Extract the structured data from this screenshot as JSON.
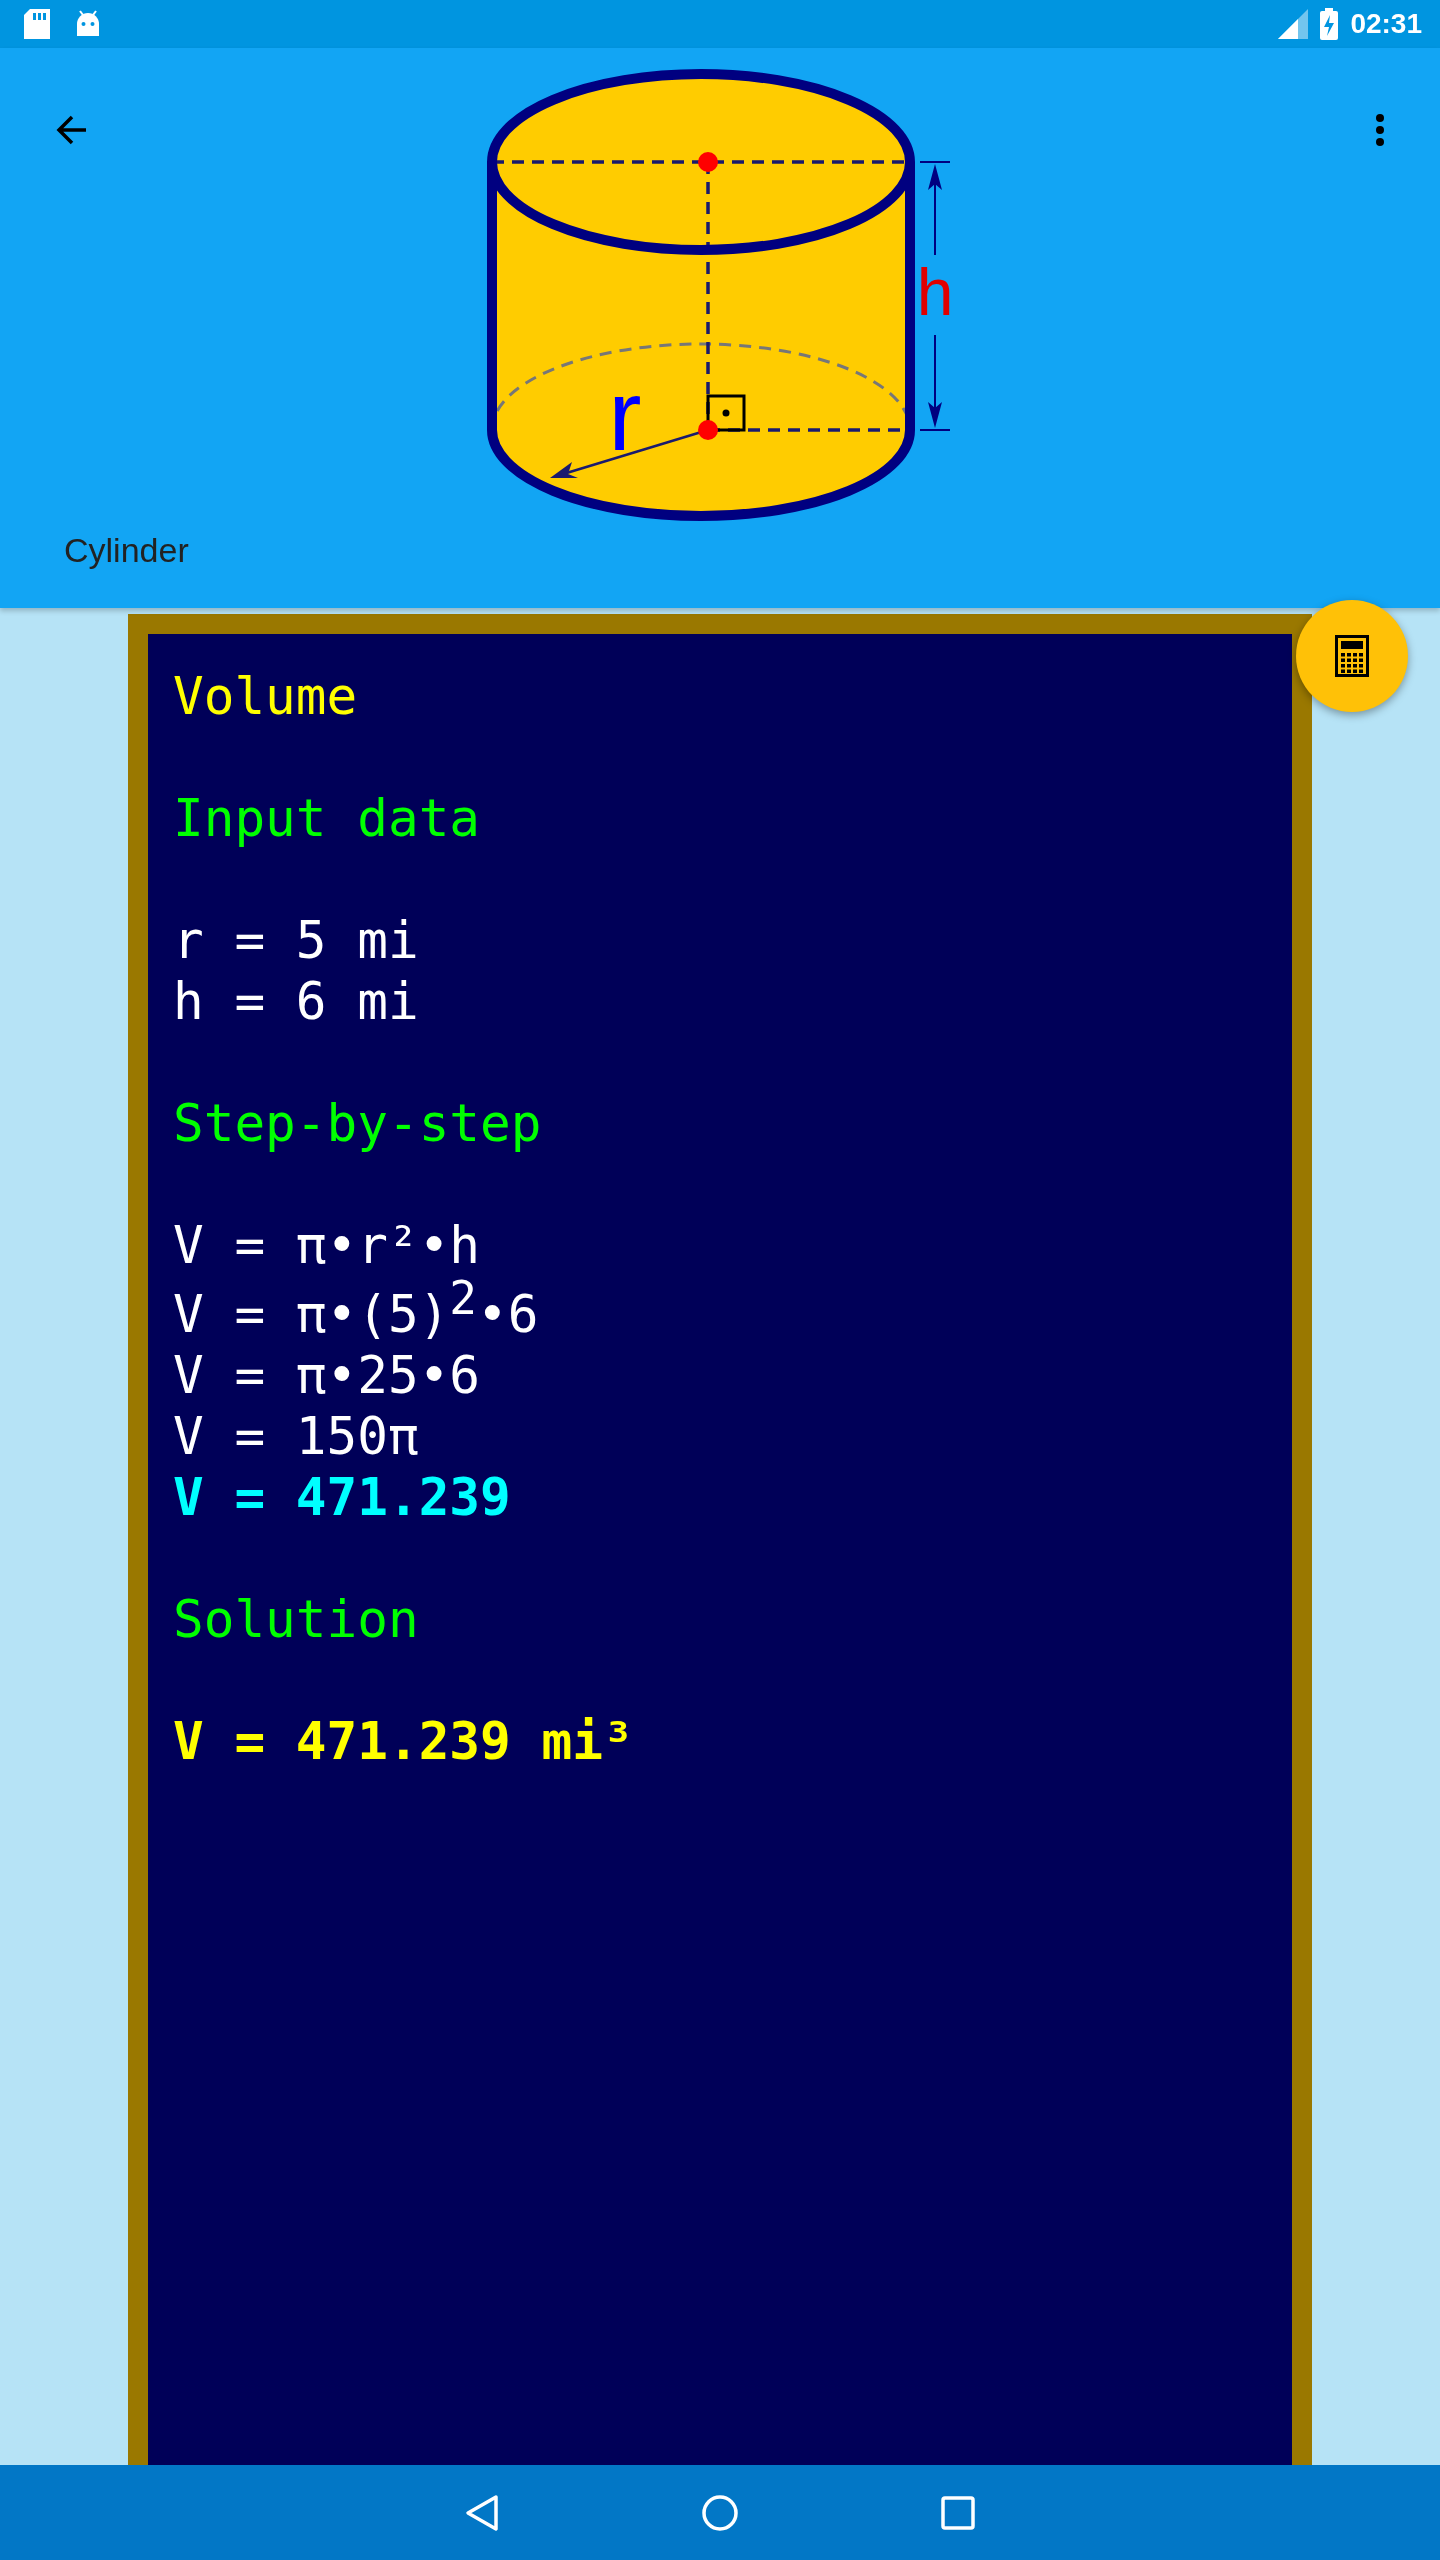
{
  "status_bar": {
    "time": "02:31"
  },
  "toolbar": {
    "title": "Cylinder"
  },
  "drawing": {
    "height_label": "h",
    "radius_label": "r"
  },
  "result": {
    "title": "Volume",
    "sections": [
      {
        "heading": "Input data",
        "lines": [
          {
            "kind": "plain",
            "text": "r = 5 mi"
          },
          {
            "kind": "plain",
            "text": "h = 6 mi"
          }
        ]
      },
      {
        "heading": "Step-by-step",
        "lines": [
          {
            "kind": "plain",
            "text": "V = π•r²•h"
          },
          {
            "kind": "plain",
            "text": "V = π•(5)$^{2}$•6"
          },
          {
            "kind": "plain",
            "text": "V = π•25•6"
          },
          {
            "kind": "plain",
            "text": "V = 150π"
          },
          {
            "kind": "result",
            "text": "V = 471.239"
          }
        ]
      },
      {
        "heading": "Solution",
        "lines": [
          {
            "kind": "solution",
            "text": "V = 471.239 mi³"
          }
        ]
      }
    ]
  }
}
